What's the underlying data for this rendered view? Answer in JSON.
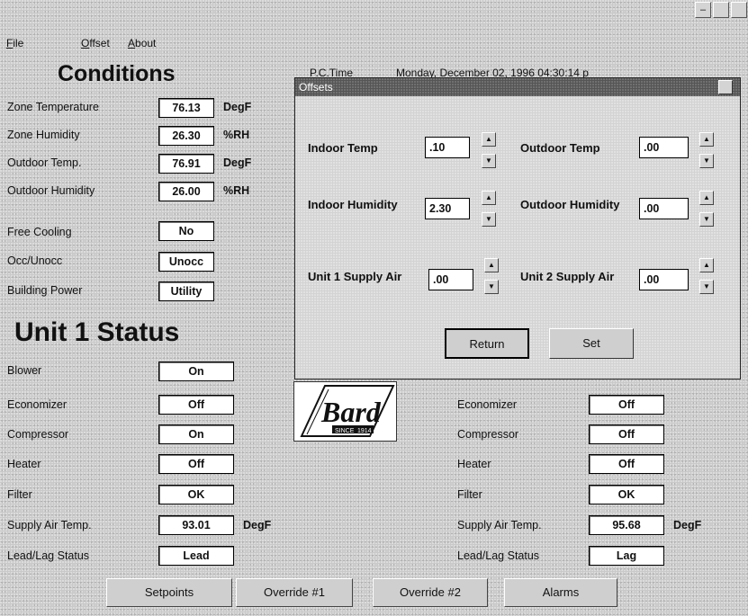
{
  "window": {
    "minimize": "–",
    "close": ""
  },
  "menu": {
    "file": "File",
    "offset": "Offset",
    "about": "About"
  },
  "pc_time": {
    "label": "P.C.Time",
    "value": "Monday, December 02, 1996  04:30:14 p"
  },
  "conditions": {
    "title": "Conditions",
    "rows": [
      {
        "label": "Zone Temperature",
        "value": "76.13",
        "unit": "DegF"
      },
      {
        "label": "Zone Humidity",
        "value": "26.30",
        "unit": "%RH"
      },
      {
        "label": "Outdoor Temp.",
        "value": "76.91",
        "unit": "DegF"
      },
      {
        "label": "Outdoor Humidity",
        "value": "26.00",
        "unit": "%RH"
      },
      {
        "label": "Free Cooling",
        "value": "No",
        "unit": ""
      },
      {
        "label": "Occ/Unocc",
        "value": "Unocc",
        "unit": ""
      },
      {
        "label": "Building Power",
        "value": "Utility",
        "unit": ""
      }
    ]
  },
  "unit1": {
    "title": "Unit 1 Status",
    "rows": [
      {
        "label": "Blower",
        "value": "On",
        "unit": ""
      },
      {
        "label": "Economizer",
        "value": "Off",
        "unit": ""
      },
      {
        "label": "Compressor",
        "value": "On",
        "unit": ""
      },
      {
        "label": "Heater",
        "value": "Off",
        "unit": ""
      },
      {
        "label": "Filter",
        "value": "OK",
        "unit": ""
      },
      {
        "label": "Supply Air Temp.",
        "value": "93.01",
        "unit": "DegF"
      },
      {
        "label": "Lead/Lag Status",
        "value": "Lead",
        "unit": ""
      }
    ]
  },
  "unit2": {
    "rows": [
      {
        "label": "Economizer",
        "value": "Off",
        "unit": ""
      },
      {
        "label": "Compressor",
        "value": "Off",
        "unit": ""
      },
      {
        "label": "Heater",
        "value": "Off",
        "unit": ""
      },
      {
        "label": "Filter",
        "value": "OK",
        "unit": ""
      },
      {
        "label": "Supply Air Temp.",
        "value": "95.68",
        "unit": "DegF"
      },
      {
        "label": "Lead/Lag Status",
        "value": "Lag",
        "unit": ""
      }
    ]
  },
  "logo": {
    "brand": "Bard",
    "since": "SINCE",
    "year": "1914"
  },
  "bottom_buttons": {
    "setpoints": "Setpoints",
    "override1": "Override #1",
    "override2": "Override #2",
    "alarms": "Alarms"
  },
  "offsets_dialog": {
    "title": "Offsets",
    "fields": {
      "indoor_temp": {
        "label": "Indoor Temp",
        "value": ".10"
      },
      "outdoor_temp": {
        "label": "Outdoor Temp",
        "value": ".00"
      },
      "indoor_humidity": {
        "label": "Indoor Humidity",
        "value": "2.30"
      },
      "outdoor_humidity": {
        "label": "Outdoor Humidity",
        "value": ".00"
      },
      "unit1_supply": {
        "label": "Unit 1 Supply Air",
        "value": ".00"
      },
      "unit2_supply": {
        "label": "Unit 2 Supply Air",
        "value": ".00"
      }
    },
    "return_label": "Return",
    "set_label": "Set"
  }
}
